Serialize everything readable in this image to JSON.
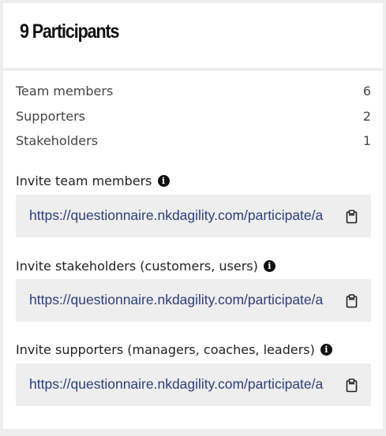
{
  "header": {
    "title": "9 Participants"
  },
  "stats": [
    {
      "label": "Team members",
      "count": "6"
    },
    {
      "label": "Supporters",
      "count": "2"
    },
    {
      "label": "Stakeholders",
      "count": "1"
    }
  ],
  "invites": [
    {
      "label": "Invite team members",
      "url": "https://questionnaire.nkdagility.com/participate/a",
      "info_icon": "info-icon",
      "copy_icon": "clipboard-icon"
    },
    {
      "label": "Invite stakeholders (customers, users)",
      "url": "https://questionnaire.nkdagility.com/participate/a",
      "info_icon": "info-icon",
      "copy_icon": "clipboard-icon"
    },
    {
      "label": "Invite supporters (managers, coaches, leaders)",
      "url": "https://questionnaire.nkdagility.com/participate/a",
      "info_icon": "info-icon",
      "copy_icon": "clipboard-icon"
    }
  ],
  "colors": {
    "background": "#eeeeee",
    "card": "#ffffff",
    "link": "#2c3e7c",
    "text": "#444444"
  }
}
